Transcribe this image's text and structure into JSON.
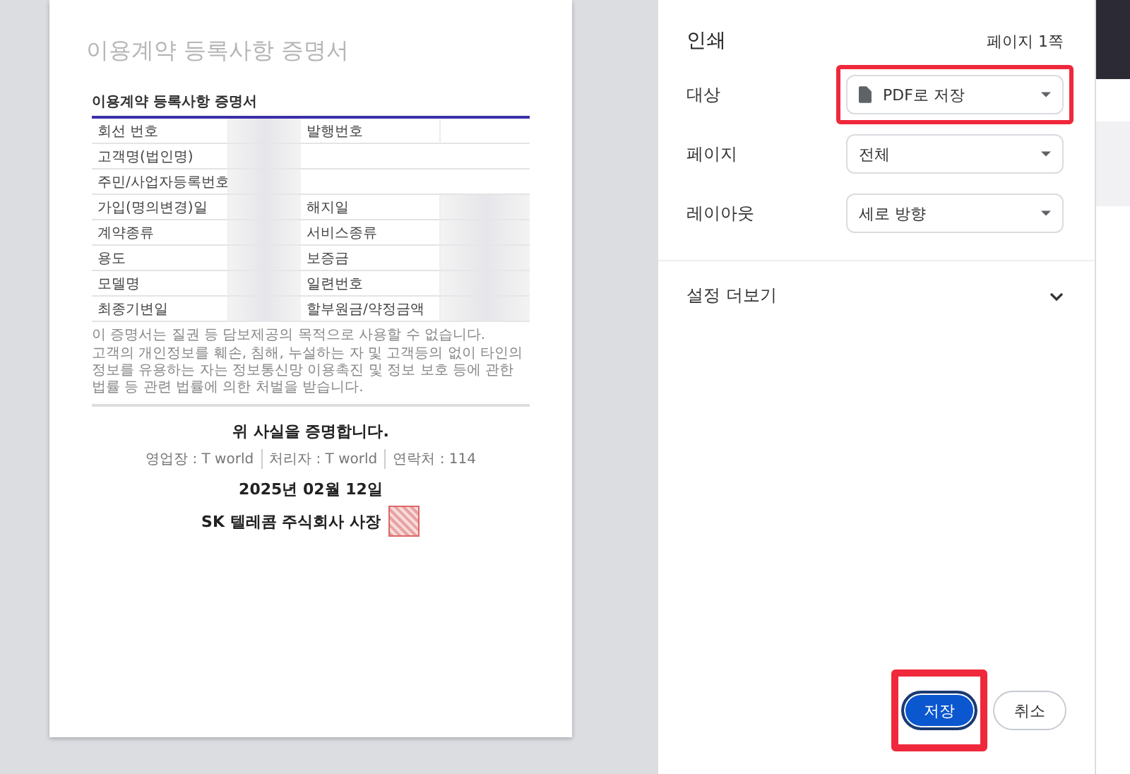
{
  "document": {
    "heading": "이용계약 등록사항 증명서",
    "table_title": "이용계약 등록사항 증명서",
    "rows": [
      {
        "label_1": "회선 번호",
        "value_1_redacted": true,
        "label_2": "발행번호",
        "value_2_redacted": false
      },
      {
        "label_1": "고객명(법인명)",
        "value_1_redacted": true
      },
      {
        "label_1": "주민/사업자등록번호",
        "value_1_redacted": true
      },
      {
        "label_1": "가입(명의변경)일",
        "value_1_redacted": true,
        "label_2": "해지일",
        "value_2_redacted": true
      },
      {
        "label_1": "계약종류",
        "value_1_redacted": true,
        "label_2": "서비스종류",
        "value_2_redacted": true
      },
      {
        "label_1": "용도",
        "value_1_redacted": true,
        "label_2": "보증금",
        "value_2_redacted": true
      },
      {
        "label_1": "모델명",
        "value_1_redacted": true,
        "label_2": "일련번호",
        "value_2_redacted": true
      },
      {
        "label_1": "최종기변일",
        "value_1_redacted": true,
        "label_2": "할부원금/약정금액",
        "value_2_redacted": true
      }
    ],
    "notes": [
      "이 증명서는 질권 등 담보제공의 목적으로 사용할 수 없습니다.",
      "고객의 개인정보를 훼손, 침해, 누설하는 자 및 고객등의 없이 타인의 정보를 유용하는 자는 정보통신망 이용촉진 및 정보 보호 등에 관한 법률 등 관련 법률에 의한 처벌을 받습니다."
    ],
    "confirmation": "위 사실을 증명합니다.",
    "issuer_info": [
      "영업장 : T world",
      "처리자 : T world",
      "연락처 : 114"
    ],
    "date": "2025년 02월 12일",
    "signature": "SK 텔레콤 주식회사 사장"
  },
  "print_panel": {
    "title": "인쇄",
    "page_count": "페이지 1쪽",
    "settings": [
      {
        "label": "대상",
        "value": "PDF로 저장",
        "kind": "destination",
        "highlighted": true
      },
      {
        "label": "페이지",
        "value": "전체",
        "kind": "select",
        "highlighted": false
      },
      {
        "label": "레이아웃",
        "value": "세로 방향",
        "kind": "select",
        "highlighted": false
      }
    ],
    "more_settings": {
      "label": "설정 더보기",
      "expanded": false
    },
    "buttons": [
      {
        "label": "저장",
        "kind": "primary",
        "highlighted": true
      },
      {
        "label": "취소",
        "kind": "secondary",
        "highlighted": false
      }
    ]
  }
}
